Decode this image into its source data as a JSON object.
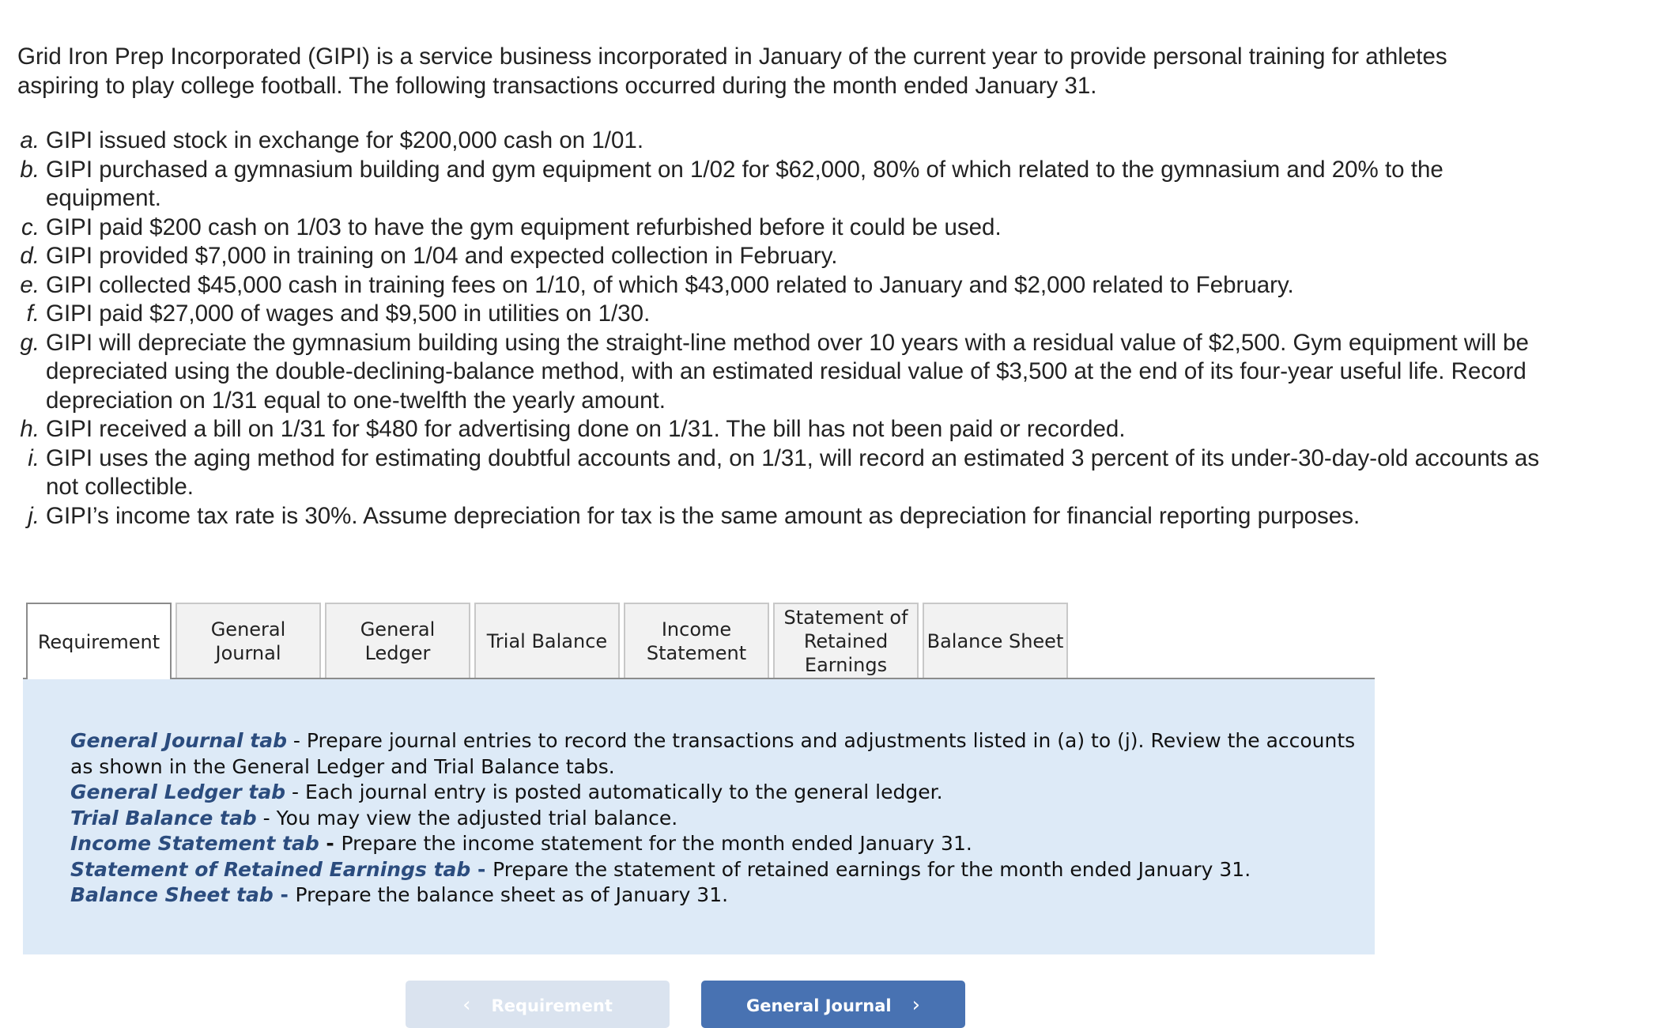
{
  "intro": "Grid Iron Prep Incorporated (GIPI) is a service business incorporated in January of the current year to provide personal training for athletes aspiring to play college football. The following transactions occurred during the month ended January 31.",
  "transactions": [
    {
      "marker": "a.",
      "text": "GIPI issued stock in exchange for $200,000 cash on 1/01."
    },
    {
      "marker": "b.",
      "text": "GIPI purchased a gymnasium building and gym equipment on 1/02 for $62,000, 80% of which related to the gymnasium and 20% to the equipment."
    },
    {
      "marker": "c.",
      "text": "GIPI paid $200 cash on 1/03 to have the gym equipment refurbished before it could be used."
    },
    {
      "marker": "d.",
      "text": "GIPI provided $7,000 in training on 1/04 and expected collection in February."
    },
    {
      "marker": "e.",
      "text": "GIPI collected $45,000 cash in training fees on 1/10, of which $43,000 related to January and $2,000 related to February."
    },
    {
      "marker": "f.",
      "text": "GIPI paid $27,000 of wages and $9,500 in utilities on 1/30."
    },
    {
      "marker": "g.",
      "text": "GIPI will depreciate the gymnasium building using the straight-line method over 10 years with a residual value of $2,500. Gym equipment will be depreciated using the double-declining-balance method, with an estimated residual value of $3,500 at the end of its four-year useful life. Record depreciation on 1/31 equal to one-twelfth the yearly amount."
    },
    {
      "marker": "h.",
      "text": "GIPI received a bill on 1/31 for $480 for advertising done on 1/31. The bill has not been paid or recorded."
    },
    {
      "marker": "i.",
      "text": "GIPI uses the aging method for estimating doubtful accounts and, on 1/31, will record an estimated 3 percent of its under-30-day-old accounts as not collectible."
    },
    {
      "marker": "j.",
      "text": "GIPI’s income tax rate is 30%. Assume depreciation for tax is the same amount as depreciation for financial reporting purposes."
    }
  ],
  "tabs": [
    {
      "label": "Requirement",
      "active": true
    },
    {
      "label": "General Journal",
      "active": false
    },
    {
      "label": "General Ledger",
      "active": false
    },
    {
      "label": "Trial Balance",
      "active": false
    },
    {
      "label": "Income Statement",
      "active": false
    },
    {
      "label": "Statement of Retained Earnings",
      "active": false
    },
    {
      "label": "Balance Sheet",
      "active": false
    }
  ],
  "instructions": [
    {
      "keyword": "General Journal tab",
      "dash": " - ",
      "text": "Prepare journal entries to record the transactions and adjustments listed in (a) to (j). Review the accounts as shown in the General Ledger and Trial Balance tabs."
    },
    {
      "keyword": "General Ledger tab",
      "dash": " - ",
      "text": "Each journal entry is posted automatically to the general ledger."
    },
    {
      "keyword": "Trial Balance tab",
      "dash": " - ",
      "text": "You may view the adjusted trial balance."
    },
    {
      "keyword": "Income Statement tab",
      "dash": " - ",
      "text": "Prepare the income statement for the month ended January 31."
    },
    {
      "keyword": "Statement of Retained Earnings tab",
      "dash": " - ",
      "text": "Prepare the statement of retained earnings for the month ended January 31."
    },
    {
      "keyword": "Balance Sheet tab",
      "dash": " - ",
      "text": "Prepare the balance sheet as of January 31."
    }
  ],
  "nav": {
    "prev_label": "Requirement",
    "prev_icon": "‹",
    "next_label": "General Journal",
    "next_icon": "›"
  },
  "colors": {
    "panel_bg": "#ddeaf7",
    "keyword": "#2b4c7e",
    "next_button": "#4872b2",
    "prev_button_disabled": "#dae3ef"
  }
}
